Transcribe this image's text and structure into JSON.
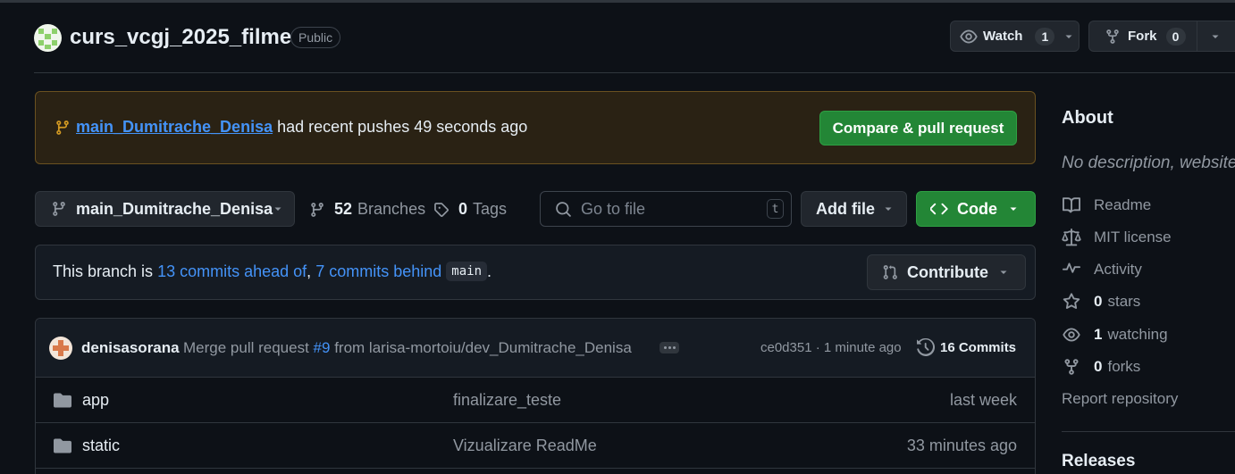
{
  "repo": {
    "name": "curs_vcgj_2025_filme",
    "visibility": "Public",
    "watch_label": "Watch",
    "watch_count": "1",
    "fork_label": "Fork",
    "fork_count": "0"
  },
  "banner": {
    "branch": "main_Dumitrache_Denisa",
    "message": "had recent pushes 49 seconds ago",
    "button": "Compare & pull request"
  },
  "toolbar": {
    "current_branch": "main_Dumitrache_Denisa",
    "branches_count": "52",
    "branches_label": "Branches",
    "tags_count": "0",
    "tags_label": "Tags",
    "search_placeholder": "Go to file",
    "search_shortcut": "t",
    "add_file": "Add file",
    "code": "Code"
  },
  "branch_status": {
    "prefix": "This branch is",
    "ahead": "13 commits ahead of",
    "comma": ",",
    "behind": "7 commits behind",
    "base": "main",
    "suffix": ".",
    "contribute": "Contribute"
  },
  "latest_commit": {
    "author": "denisasorana",
    "message_prefix": "Merge pull request",
    "pr_link": "#9",
    "message_suffix": "from larisa-mortoiu/dev_Dumitrache_Denisa",
    "hash_time": "ce0d351 · 1 minute ago",
    "commits_label": "16 Commits"
  },
  "files": [
    {
      "name": "app",
      "message": "finalizare_teste",
      "time": "last week"
    },
    {
      "name": "static",
      "message": "Vizualizare ReadMe",
      "time": "33 minutes ago"
    }
  ],
  "about": {
    "heading": "About",
    "description": "No description, website",
    "readme": "Readme",
    "license": "MIT license",
    "activity": "Activity",
    "stars_count": "0",
    "stars_label": "stars",
    "watching_count": "1",
    "watching_label": "watching",
    "forks_count": "0",
    "forks_label": "forks",
    "report": "Report repository",
    "releases": "Releases"
  },
  "colors": {
    "background": "#0d1117",
    "border": "#30363d",
    "button_bg": "#21262d",
    "link": "#4493f8",
    "green": "#238636",
    "banner_bg": "#2a2214",
    "banner_border": "#6a5120",
    "muted": "#7d8590"
  },
  "icons": [
    "repo-avatar",
    "eye-icon",
    "fork-icon",
    "caret-down-icon",
    "branch-icon",
    "tag-icon",
    "search-icon",
    "code-icon",
    "pull-request-icon",
    "kebab-icon",
    "history-icon",
    "folder-icon",
    "book-icon",
    "scale-icon",
    "pulse-icon",
    "star-icon",
    "repo-forked-icon"
  ]
}
